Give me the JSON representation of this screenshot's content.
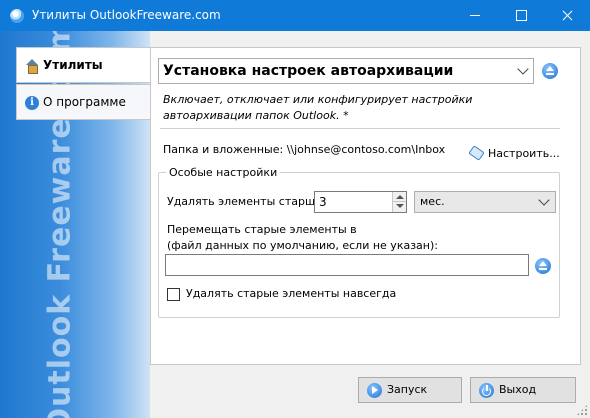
{
  "window": {
    "title": "Утилиты OutlookFreeware.com",
    "brand_text": "Outlook Freeware .com"
  },
  "tabs": [
    {
      "label": "Утилиты",
      "icon": "home-icon",
      "active": true
    },
    {
      "label": "О программе",
      "icon": "info-icon",
      "active": false
    }
  ],
  "utility": {
    "selected": "Установка настроек автоархивации",
    "description_line1": "Включает, отключает или конфигурирует настройки",
    "description_line2": "автоархивации папок Outlook. *"
  },
  "folder": {
    "label": "Папка и вложенные: \\\\johnse@contoso.com\\Inbox",
    "configure_label": "Настроить..."
  },
  "special": {
    "group_title": "Особые настройки",
    "older_label": "Удалять элементы старше",
    "older_value": "3",
    "unit_value": "мес.",
    "move_label_line1": "Перемещать старые элементы в",
    "move_label_line2": "(файл данных по умолчанию, если не указан):",
    "move_path": "",
    "delete_forever_label": "Удалять старые элементы навсегда",
    "delete_forever_checked": false
  },
  "buttons": {
    "run_label": "Запуск",
    "exit_label": "Выход"
  },
  "icons": {
    "app": "outlookfreeware-icon",
    "eject": "eject-icon",
    "configure": "tag-icon",
    "run": "play-icon",
    "exit": "power-icon",
    "info_glyph": "i"
  },
  "colors": {
    "titlebar": "#0f7ad8",
    "sideband": "#3b8ddc",
    "accent": "#1d6fd1"
  }
}
